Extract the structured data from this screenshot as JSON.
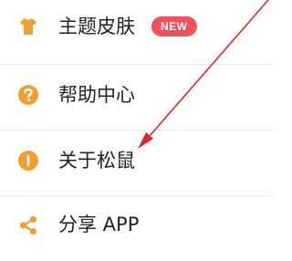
{
  "menu": {
    "items": [
      {
        "label": "主题皮肤",
        "icon": "tshirt-icon",
        "badge": "NEW"
      },
      {
        "label": "帮助中心",
        "icon": "question-circle-icon"
      },
      {
        "label": "关于松鼠",
        "icon": "info-circle-icon"
      },
      {
        "label": "分享 APP",
        "icon": "share-icon"
      }
    ]
  },
  "colors": {
    "icon": "#f0a030",
    "badge": "#f2505a",
    "annotation_arrow": "#d42a2a",
    "text": "#222222",
    "divider": "#e9e9e9"
  }
}
